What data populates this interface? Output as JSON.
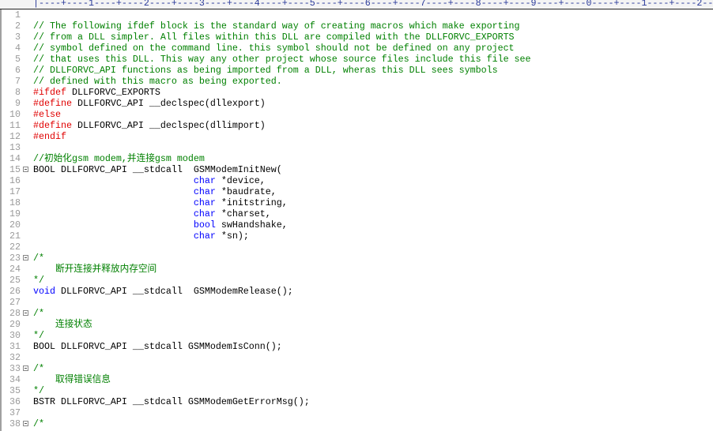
{
  "ruler": "|----+----1----+----2----+----3----+----4----+----5----+----6----+----7----+----8----+----9----+----0----+----1----+----2---",
  "colors": {
    "comment": "#008000",
    "preprocessor": "#e00000",
    "keyword": "#0000ff",
    "line_number": "#9a9a9a"
  },
  "lines": [
    {
      "n": "1",
      "fold": false,
      "tokens": []
    },
    {
      "n": "2",
      "fold": false,
      "tokens": [
        [
          "cm",
          "// The following ifdef block is the standard way of creating macros which make exporting"
        ]
      ]
    },
    {
      "n": "3",
      "fold": false,
      "tokens": [
        [
          "cm",
          "// from a DLL simpler. All files within this DLL are compiled with the DLLFORVC_EXPORTS"
        ]
      ]
    },
    {
      "n": "4",
      "fold": false,
      "tokens": [
        [
          "cm",
          "// symbol defined on the command line. this symbol should not be defined on any project"
        ]
      ]
    },
    {
      "n": "5",
      "fold": false,
      "tokens": [
        [
          "cm",
          "// that uses this DLL. This way any other project whose source files include this file see"
        ]
      ]
    },
    {
      "n": "6",
      "fold": false,
      "tokens": [
        [
          "cm",
          "// DLLFORVC_API functions as being imported from a DLL, wheras this DLL sees symbols"
        ]
      ]
    },
    {
      "n": "7",
      "fold": false,
      "tokens": [
        [
          "cm",
          "// defined with this macro as being exported."
        ]
      ]
    },
    {
      "n": "8",
      "fold": false,
      "tokens": [
        [
          "pp",
          "#ifdef"
        ],
        [
          "tx",
          " DLLFORVC_EXPORTS"
        ]
      ]
    },
    {
      "n": "9",
      "fold": false,
      "tokens": [
        [
          "pp",
          "#define"
        ],
        [
          "tx",
          " DLLFORVC_API __declspec(dllexport)"
        ]
      ]
    },
    {
      "n": "10",
      "fold": false,
      "tokens": [
        [
          "pp",
          "#else"
        ]
      ]
    },
    {
      "n": "11",
      "fold": false,
      "tokens": [
        [
          "pp",
          "#define"
        ],
        [
          "tx",
          " DLLFORVC_API __declspec(dllimport)"
        ]
      ]
    },
    {
      "n": "12",
      "fold": false,
      "tokens": [
        [
          "pp",
          "#endif"
        ]
      ]
    },
    {
      "n": "13",
      "fold": false,
      "tokens": []
    },
    {
      "n": "14",
      "fold": false,
      "tokens": [
        [
          "cm",
          "//初始化gsm modem,并连接gsm modem"
        ]
      ]
    },
    {
      "n": "15",
      "fold": true,
      "tokens": [
        [
          "tx",
          "BOOL DLLFORVC_API __stdcall  GSMModemInitNew("
        ]
      ]
    },
    {
      "n": "16",
      "fold": false,
      "tokens": [
        [
          "tx",
          "                             "
        ],
        [
          "kw",
          "char"
        ],
        [
          "tx",
          " *device,"
        ]
      ]
    },
    {
      "n": "17",
      "fold": false,
      "tokens": [
        [
          "tx",
          "                             "
        ],
        [
          "kw",
          "char"
        ],
        [
          "tx",
          " *baudrate,"
        ]
      ]
    },
    {
      "n": "18",
      "fold": false,
      "tokens": [
        [
          "tx",
          "                             "
        ],
        [
          "kw",
          "char"
        ],
        [
          "tx",
          " *initstring,"
        ]
      ]
    },
    {
      "n": "19",
      "fold": false,
      "tokens": [
        [
          "tx",
          "                             "
        ],
        [
          "kw",
          "char"
        ],
        [
          "tx",
          " *charset,"
        ]
      ]
    },
    {
      "n": "20",
      "fold": false,
      "tokens": [
        [
          "tx",
          "                             "
        ],
        [
          "kw",
          "bool"
        ],
        [
          "tx",
          " swHandshake,"
        ]
      ]
    },
    {
      "n": "21",
      "fold": false,
      "tokens": [
        [
          "tx",
          "                             "
        ],
        [
          "kw",
          "char"
        ],
        [
          "tx",
          " *sn);"
        ]
      ]
    },
    {
      "n": "22",
      "fold": false,
      "tokens": []
    },
    {
      "n": "23",
      "fold": true,
      "tokens": [
        [
          "cm",
          "/*"
        ]
      ]
    },
    {
      "n": "24",
      "fold": false,
      "tokens": [
        [
          "cm",
          "    断开连接并释放内存空间"
        ]
      ]
    },
    {
      "n": "25",
      "fold": false,
      "tokens": [
        [
          "cm",
          "*/"
        ]
      ]
    },
    {
      "n": "26",
      "fold": false,
      "tokens": [
        [
          "kw",
          "void"
        ],
        [
          "tx",
          " DLLFORVC_API __stdcall  GSMModemRelease();"
        ]
      ]
    },
    {
      "n": "27",
      "fold": false,
      "tokens": []
    },
    {
      "n": "28",
      "fold": true,
      "tokens": [
        [
          "cm",
          "/*"
        ]
      ]
    },
    {
      "n": "29",
      "fold": false,
      "tokens": [
        [
          "cm",
          "    连接状态"
        ]
      ]
    },
    {
      "n": "30",
      "fold": false,
      "tokens": [
        [
          "cm",
          "*/"
        ]
      ]
    },
    {
      "n": "31",
      "fold": false,
      "tokens": [
        [
          "tx",
          "BOOL DLLFORVC_API __stdcall GSMModemIsConn();"
        ]
      ]
    },
    {
      "n": "32",
      "fold": false,
      "tokens": []
    },
    {
      "n": "33",
      "fold": true,
      "tokens": [
        [
          "cm",
          "/*"
        ]
      ]
    },
    {
      "n": "34",
      "fold": false,
      "tokens": [
        [
          "cm",
          "    取得错误信息"
        ]
      ]
    },
    {
      "n": "35",
      "fold": false,
      "tokens": [
        [
          "cm",
          "*/"
        ]
      ]
    },
    {
      "n": "36",
      "fold": false,
      "tokens": [
        [
          "tx",
          "BSTR DLLFORVC_API __stdcall GSMModemGetErrorMsg();"
        ]
      ]
    },
    {
      "n": "37",
      "fold": false,
      "tokens": []
    },
    {
      "n": "38",
      "fold": true,
      "tokens": [
        [
          "cm",
          "/*"
        ]
      ]
    }
  ]
}
